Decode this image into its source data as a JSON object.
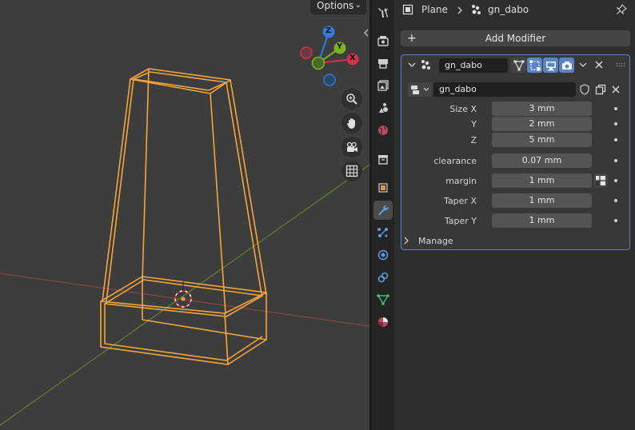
{
  "viewport": {
    "options_label": "Options",
    "gizmo": {
      "z_label": "Z",
      "y_label": "Y",
      "x_label": "X"
    },
    "nav_buttons": [
      "zoom-icon",
      "hand-pan-icon",
      "camera-icon",
      "grid-icon"
    ]
  },
  "colors": {
    "wire_selected": "#f5a63a",
    "axis_x": "#a04a4a",
    "axis_y": "#6a8f2c",
    "gizmo_x": "#d6314a",
    "gizmo_y": "#7ab51d",
    "gizmo_z": "#2f7bd9",
    "panel_accent": "#5b84c8"
  },
  "side_tabs": [
    "tool-icon",
    "render-icon",
    "output-icon",
    "view-layer-icon",
    "scene-icon",
    "world-icon",
    "collection-icon",
    "object-icon",
    "modifier-icon",
    "particles-icon",
    "physics-icon",
    "constraints-icon",
    "data-icon",
    "material-icon"
  ],
  "properties": {
    "breadcrumb": {
      "object": "Plane",
      "modifier": "gn_dabo"
    },
    "add_modifier_label": "Add Modifier",
    "modifier": {
      "name": "gn_dabo",
      "node_group": "gn_dabo",
      "rows": [
        {
          "label": "Size X",
          "value": "3 mm"
        },
        {
          "label": "Y",
          "value": "2 mm"
        },
        {
          "label": "Z",
          "value": "5 mm"
        },
        {
          "label": "clearance",
          "value": "0.07 mm"
        },
        {
          "label": "margin",
          "value": "1 mm"
        },
        {
          "label": "Taper X",
          "value": "1 mm"
        },
        {
          "label": "Taper Y",
          "value": "1 mm"
        }
      ],
      "manage_label": "Manage"
    }
  }
}
